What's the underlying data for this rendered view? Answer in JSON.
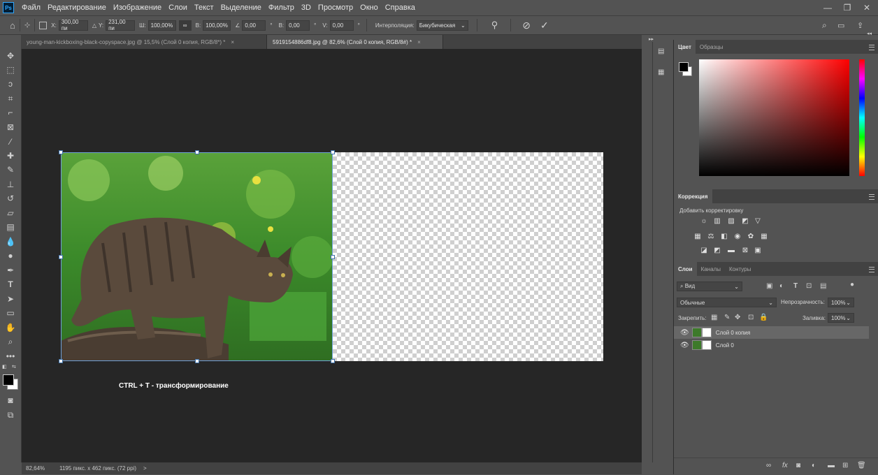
{
  "app": {
    "logo": "Ps",
    "menu": [
      "Файл",
      "Редактирование",
      "Изображение",
      "Слои",
      "Текст",
      "Выделение",
      "Фильтр",
      "3D",
      "Просмотр",
      "Окно",
      "Справка"
    ]
  },
  "options": {
    "x_label": "X:",
    "x_value": "300,00 пи",
    "y_label": "Y:",
    "y_value": "231,00 пи",
    "w_label": "Ш:",
    "w_value": "100,00%",
    "h_label": "В:",
    "h_value": "100,00%",
    "angle_value": "0,00",
    "angle_unit": "°",
    "hskew_label": "В:",
    "hskew_value": "0,00",
    "vskew_label": "V:",
    "vskew_value": "0,00",
    "interp_label": "Интерполяция:",
    "interp_value": "Бикубическая"
  },
  "tabs": [
    {
      "label": "young-man-kickboxing-black-copyspace.jpg @ 15,5% (Слой 0 копия, RGB/8*) *",
      "close": "×"
    },
    {
      "label": "5919154886df8.jpg @ 82,6% (Слой 0 копия, RGB/8#) *",
      "close": "×"
    }
  ],
  "canvas": {
    "hint": "CTRL + T - трансформирование"
  },
  "status": {
    "zoom": "82,64%",
    "doc_info": "1195 пикс. x 462 пикс. (72 ppi)",
    "arrow": ">"
  },
  "color_panel": {
    "tabs": [
      "Цвет",
      "Образцы"
    ]
  },
  "adjustments": {
    "tab": "Коррекция",
    "subtitle": "Добавить корректировку"
  },
  "layers_panel": {
    "tabs": [
      "Слои",
      "Каналы",
      "Контуры"
    ],
    "filter": "Вид",
    "blend_mode": "Обычные",
    "opacity_label": "Непрозрачность:",
    "opacity_value": "100%",
    "lock_label": "Закрепить:",
    "fill_label": "Заливка:",
    "fill_value": "100%",
    "layers": [
      {
        "name": "Слой 0 копия",
        "selected": true
      },
      {
        "name": "Слой 0",
        "selected": false
      }
    ]
  },
  "icons": {
    "tools": [
      "move-icon",
      "marquee-icon",
      "lasso-icon",
      "object-select-icon",
      "crop-icon",
      "frame-icon",
      "eyedropper-icon",
      "healing-icon",
      "brush-icon",
      "stamp-icon",
      "history-brush-icon",
      "eraser-icon",
      "gradient-icon",
      "blur-icon",
      "dodge-icon",
      "pen-icon",
      "type-icon",
      "path-select-icon",
      "rectangle-icon",
      "hand-icon",
      "zoom-icon",
      "more-icon"
    ]
  }
}
